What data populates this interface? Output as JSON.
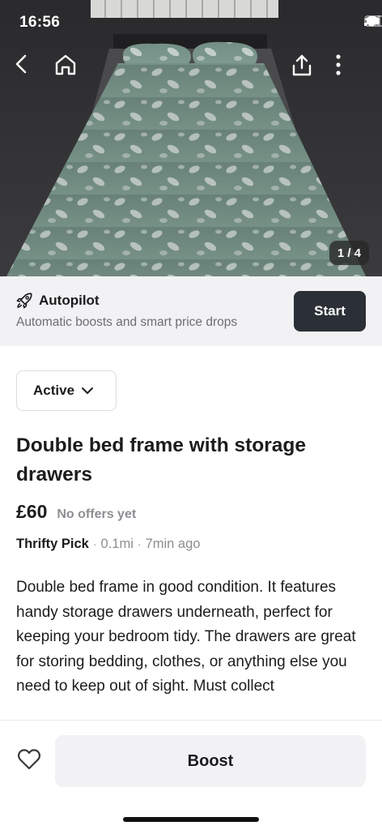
{
  "status_bar": {
    "time": "16:56"
  },
  "gallery": {
    "counter": "1 / 4"
  },
  "autopilot": {
    "title": "Autopilot",
    "subtitle": "Automatic boosts and smart price drops",
    "start_label": "Start"
  },
  "listing": {
    "status": "Active",
    "title": "Double bed frame with storage drawers",
    "price": "£60",
    "offers": "No offers yet",
    "seller": "Thrifty Pick",
    "distance": "0.1mi",
    "posted": "7min ago",
    "description": "Double bed frame in good condition. It features handy storage drawers underneath, perfect for keeping your bedroom tidy. The drawers are great for storing bedding, clothes, or anything else you need to keep out of sight. Must collect"
  },
  "bottom_bar": {
    "boost_label": "Boost"
  },
  "icons": {
    "back": "chevron-left-icon",
    "home": "home-icon",
    "share": "share-icon",
    "more": "more-vertical-icon",
    "autopilot": "rocket-icon",
    "dropdown": "chevron-down-icon",
    "like": "heart-icon"
  },
  "colors": {
    "start_button": "#2b3036",
    "banner_bg": "#f2f2f4",
    "muted_text": "#8e8e93"
  }
}
